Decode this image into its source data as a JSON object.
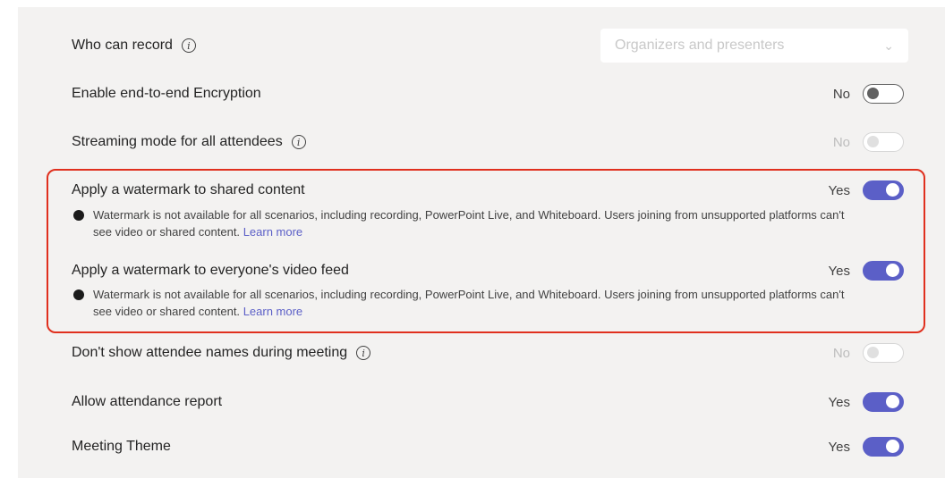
{
  "settings": {
    "who_can_record": {
      "label": "Who can record",
      "value": "Organizers and presenters"
    },
    "encryption": {
      "label": "Enable end-to-end Encryption",
      "state": "No"
    },
    "streaming": {
      "label": "Streaming mode for all attendees",
      "state": "No"
    },
    "watermark_content": {
      "label": "Apply a watermark to shared content",
      "state": "Yes",
      "note": "Watermark is not available for all scenarios, including recording, PowerPoint Live, and Whiteboard. Users joining from unsupported platforms can't see video or shared content.",
      "link": "Learn more"
    },
    "watermark_video": {
      "label": "Apply a watermark to everyone's video feed",
      "state": "Yes",
      "note": "Watermark is not available for all scenarios, including recording, PowerPoint Live, and Whiteboard. Users joining from unsupported platforms can't see video or shared content.",
      "link": "Learn more"
    },
    "hide_names": {
      "label": "Don't show attendee names during meeting",
      "state": "No"
    },
    "attendance": {
      "label": "Allow attendance report",
      "state": "Yes"
    },
    "theme": {
      "label": "Meeting Theme",
      "state": "Yes"
    }
  },
  "colors": {
    "accent": "#5b5fc7",
    "highlight_border": "#e0301e",
    "panel_bg": "#f3f2f1"
  }
}
